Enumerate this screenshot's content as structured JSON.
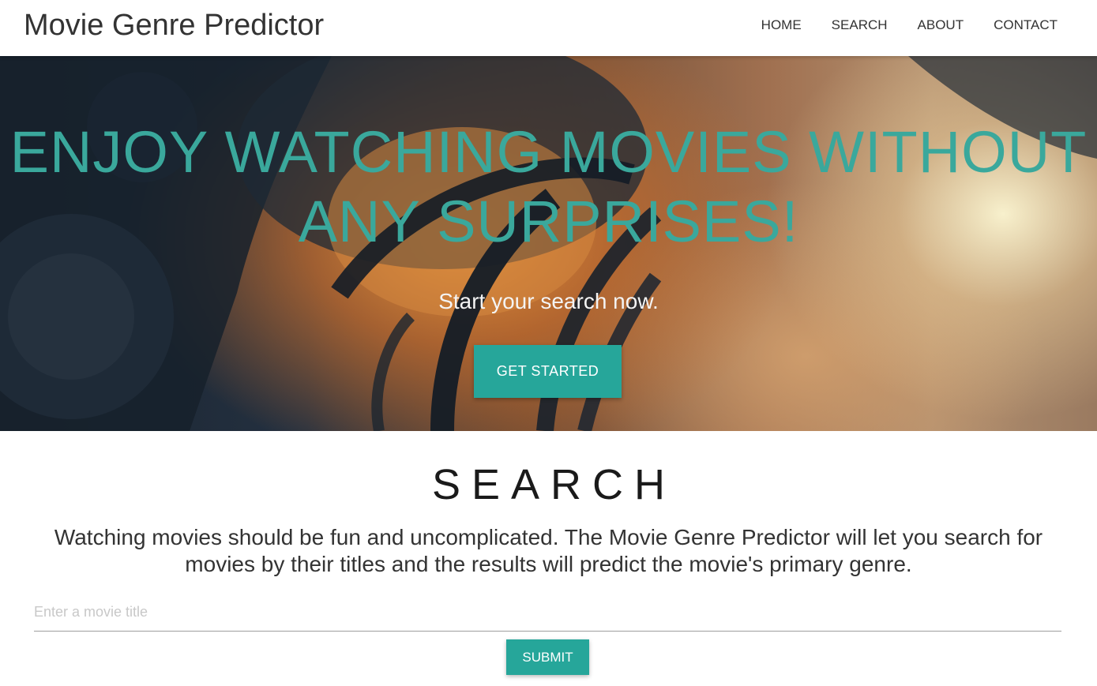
{
  "navbar": {
    "brand": "Movie Genre Predictor",
    "links": [
      "HOME",
      "SEARCH",
      "ABOUT",
      "CONTACT"
    ]
  },
  "hero": {
    "title_line1": "ENJOY WATCHING MOVIES WITHOUT",
    "title_line2": "ANY SURPRISES!",
    "subtitle": "Start your search now.",
    "cta_label": "GET STARTED"
  },
  "search": {
    "heading": "SEARCH",
    "description": "Watching movies should be fun and uncomplicated. The Movie Genre Predictor will let you search for movies by their titles and the results will predict the movie's primary genre.",
    "input_placeholder": "Enter a movie title",
    "input_value": "",
    "submit_label": "SUBMIT"
  },
  "colors": {
    "accent": "#26a69a",
    "hero_title": "#3aa89c",
    "text": "#333333"
  }
}
